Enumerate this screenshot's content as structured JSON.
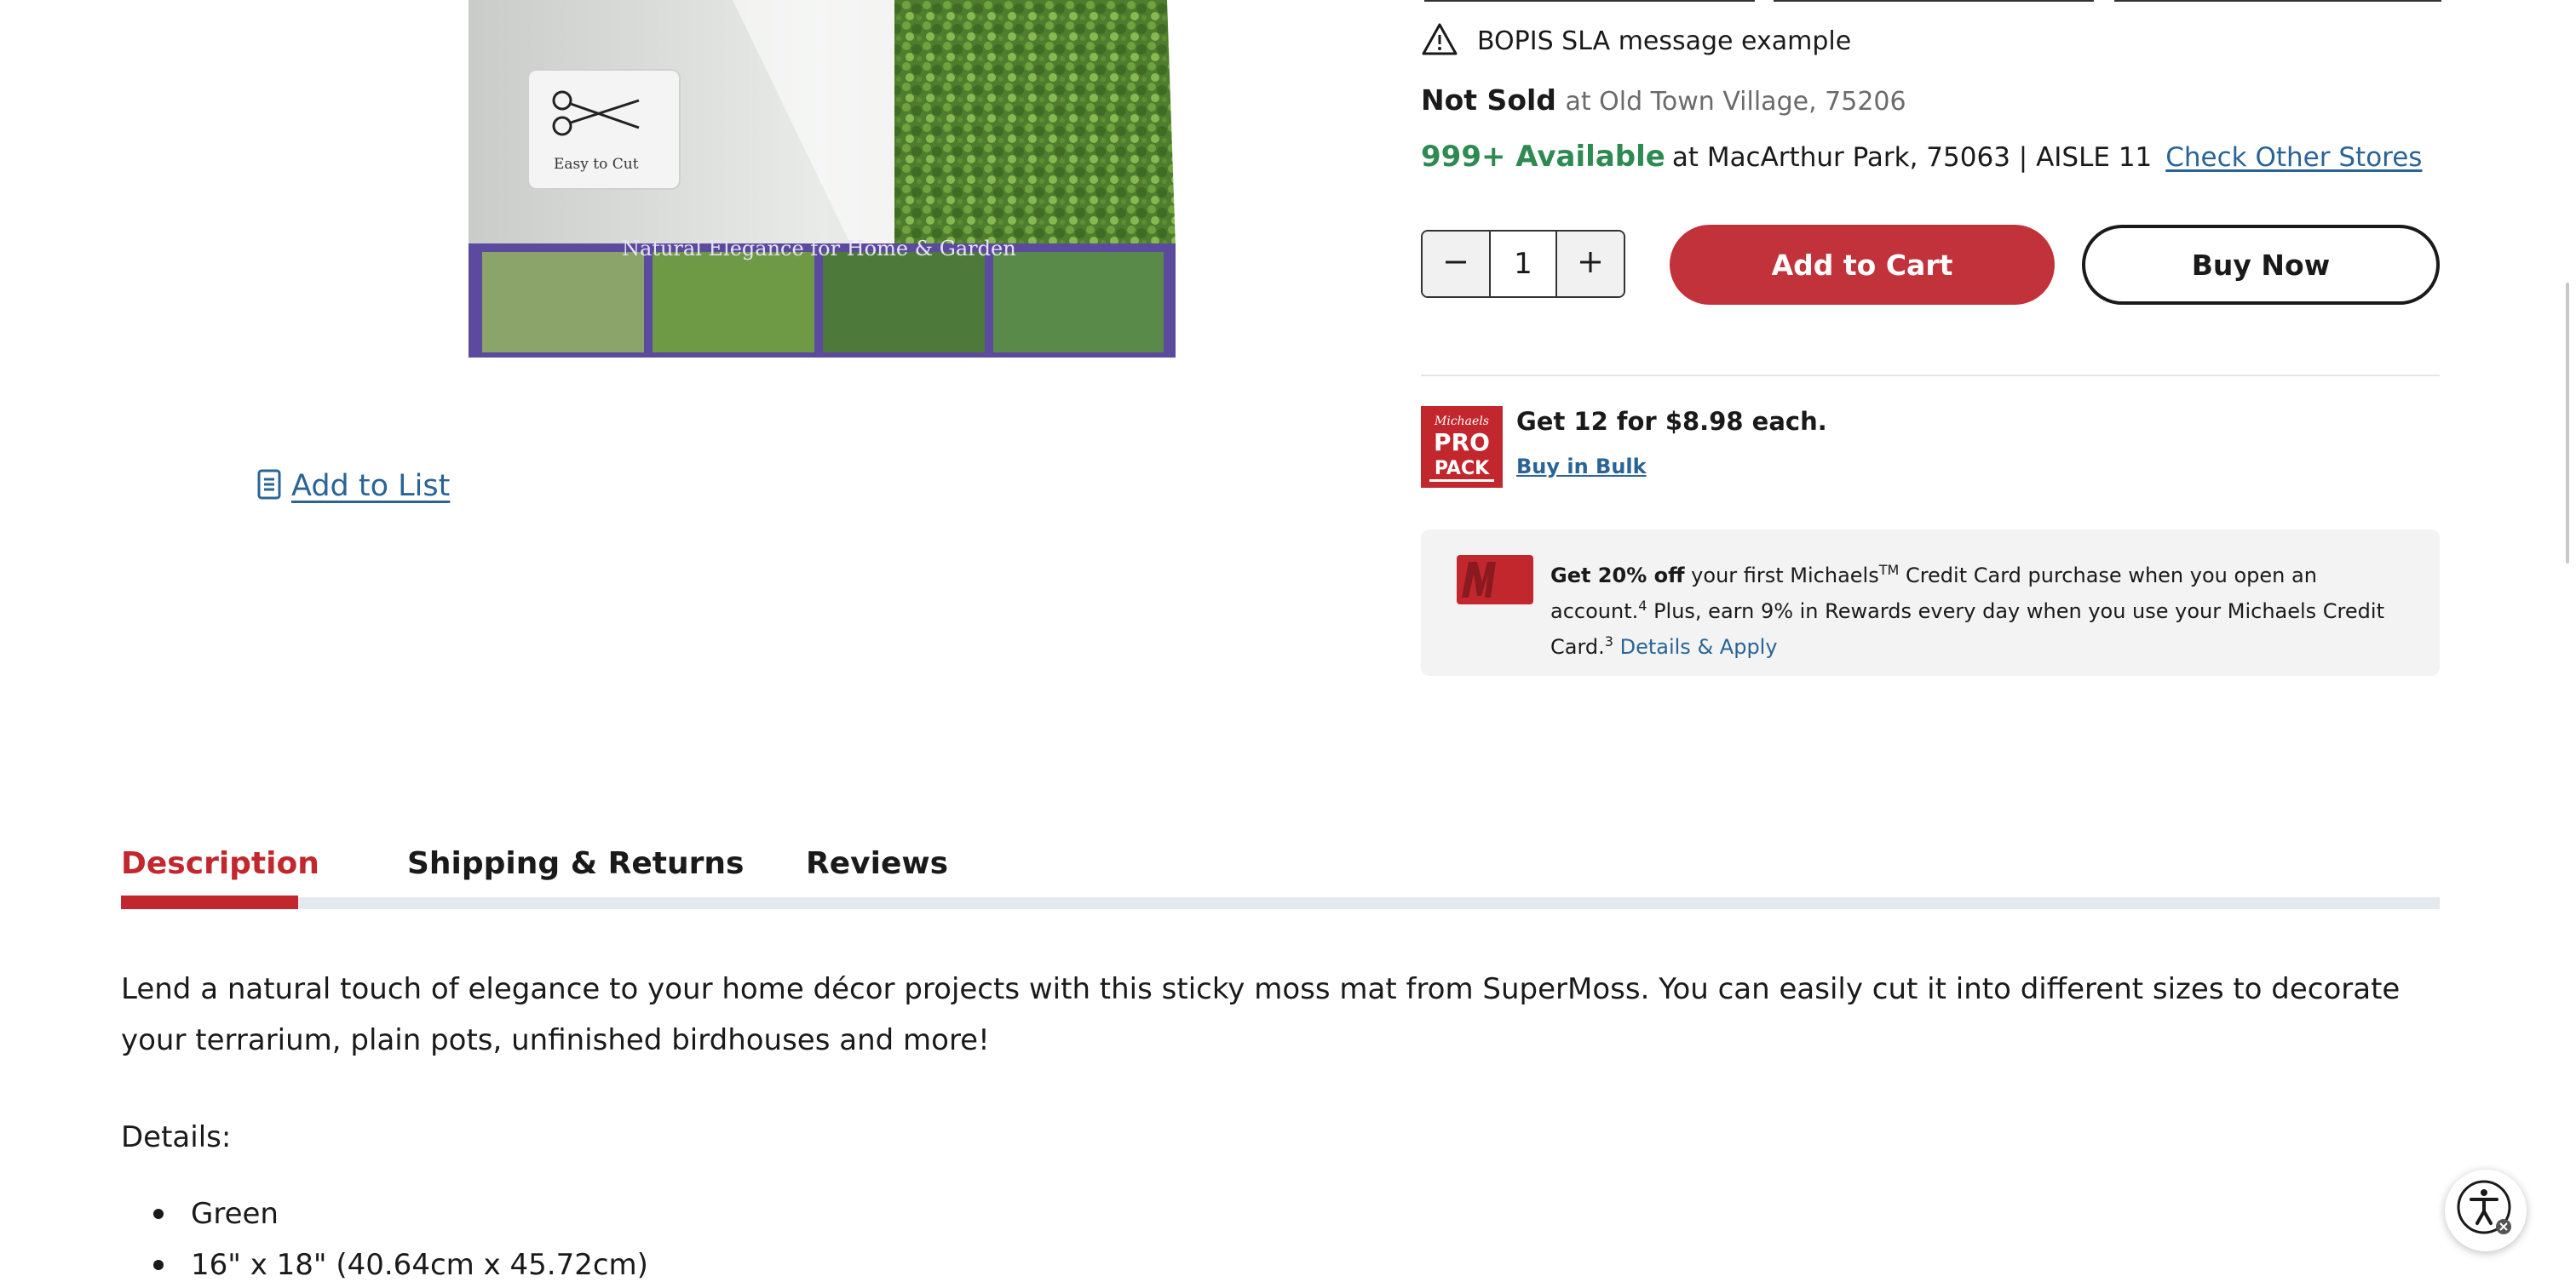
{
  "product": {
    "image_alt": "SuperMoss Instant Green sticky moss mat",
    "image_texts": [
      "Easy to Cut",
      "Natural Elegance for Home & Garden"
    ]
  },
  "actions": {
    "add_to_list": "Add to List"
  },
  "fulfillment": {
    "bopis_message": "BOPIS SLA message example",
    "not_sold_label": "Not Sold",
    "not_sold_location": "at Old Town Village, 75206",
    "available_label": "999+ Available",
    "available_location": "at MacArthur Park, 75063 | AISLE 11",
    "check_stores": "Check Other Stores"
  },
  "purchase": {
    "quantity": "1",
    "add_to_cart": "Add to Cart",
    "buy_now": "Buy Now"
  },
  "bulk": {
    "badge_lines": [
      "Michaels",
      "PRO",
      "PACK"
    ],
    "offer": "Get 12 for $8.98 each.",
    "link": "Buy in Bulk"
  },
  "credit": {
    "bold": "Get 20% off",
    "text1": " your first Michaels",
    "tm": "TM",
    "text2": " Credit Card purchase when you open an account.",
    "sup1": "4",
    "text3": " Plus, earn 9% in Rewards every day when you use your Michaels Credit Card.",
    "sup2": "3",
    "link": "Details & Apply"
  },
  "tabs": {
    "description": "Description",
    "shipping": "Shipping & Returns",
    "reviews": "Reviews"
  },
  "description": {
    "body": "Lend a natural touch of elegance to your home décor projects with this sticky moss mat from SuperMoss. You can easily cut it into different sizes to decorate your terrarium, plain pots, unfinished birdhouses and more!",
    "details_label": "Details:",
    "bullets": [
      "Green",
      "16\" x 18\" (40.64cm x 45.72cm)"
    ]
  },
  "colors": {
    "brand_red": "#c1272d",
    "link_blue": "#2a6496",
    "available_green": "#2f8a52"
  },
  "icons": {
    "warning": "warning-triangle-icon",
    "list": "list-document-icon",
    "minus": "minus-icon",
    "plus": "plus-icon",
    "accessibility": "accessibility-icon"
  }
}
